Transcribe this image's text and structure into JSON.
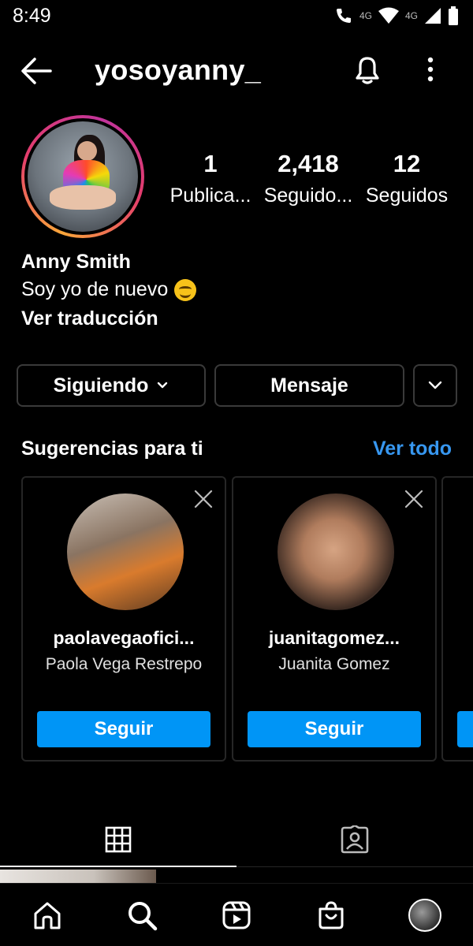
{
  "status": {
    "time": "8:49",
    "network_label": "4G",
    "network_label_2": "4G"
  },
  "header": {
    "username": "yosoyanny_"
  },
  "profile": {
    "full_name": "Anny Smith",
    "bio": "Soy yo de nuevo",
    "translate_label": "Ver traducción",
    "stats": [
      {
        "value": "1",
        "label": "Publica..."
      },
      {
        "value": "2,418",
        "label": "Seguido..."
      },
      {
        "value": "12",
        "label": "Seguidos"
      }
    ]
  },
  "actions": {
    "following_label": "Siguiendo",
    "message_label": "Mensaje"
  },
  "suggestions": {
    "title": "Sugerencias para ti",
    "see_all": "Ver todo",
    "cards": [
      {
        "username": "paolavegaofici...",
        "name": "Paola Vega Restrepo",
        "follow_label": "Seguir"
      },
      {
        "username": "juanitagomez...",
        "name": "Juanita Gomez",
        "follow_label": "Seguir"
      }
    ]
  },
  "colors": {
    "accent": "#0095f6",
    "link": "#3797f0",
    "background": "#000000",
    "border": "#3a3a3a"
  },
  "icons": {
    "header": [
      "back-arrow-icon",
      "bell-icon",
      "more-vertical-icon"
    ],
    "tabs": [
      "grid-icon",
      "tagged-icon"
    ],
    "nav": [
      "home-icon",
      "search-icon",
      "reels-icon",
      "shop-icon",
      "profile-avatar"
    ]
  }
}
